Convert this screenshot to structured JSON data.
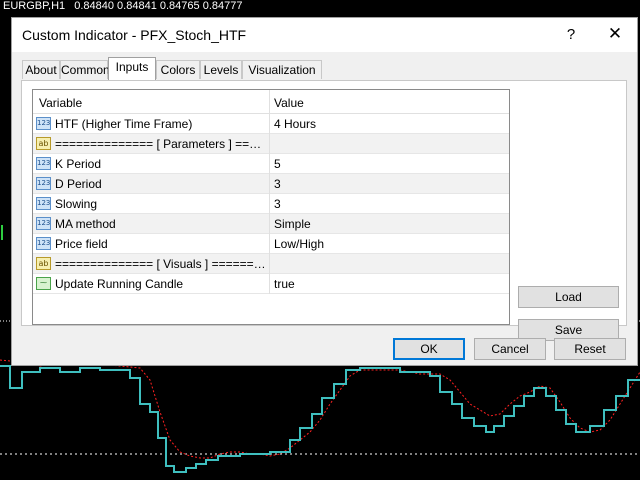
{
  "chart": {
    "symbol": "EURGBP,H1",
    "prices": [
      "0.84840",
      "0.84841",
      "0.84765",
      "0.84777"
    ],
    "stoch_color": "#3fbfbf",
    "signal_color": "#ff2020"
  },
  "dialog": {
    "title": "Custom Indicator - PFX_Stoch_HTF",
    "help_glyph": "?",
    "close_glyph": "✕",
    "tabs": [
      {
        "label": "About"
      },
      {
        "label": "Common"
      },
      {
        "label": "Inputs",
        "active": true
      },
      {
        "label": "Colors"
      },
      {
        "label": "Levels"
      },
      {
        "label": "Visualization"
      }
    ],
    "table": {
      "headers": {
        "variable": "Variable",
        "value": "Value"
      },
      "rows": [
        {
          "icon": "123",
          "type": "number-icon",
          "variable": "HTF (Higher Time Frame)",
          "value": "4 Hours"
        },
        {
          "icon": "ab",
          "type": "string-icon",
          "variable": "============== [ Parameters ] ==============",
          "value": ""
        },
        {
          "icon": "123",
          "type": "number-icon",
          "variable": "K Period",
          "value": "5"
        },
        {
          "icon": "123",
          "type": "number-icon",
          "variable": "D Period",
          "value": "3"
        },
        {
          "icon": "123",
          "type": "number-icon",
          "variable": "Slowing",
          "value": "3"
        },
        {
          "icon": "123",
          "type": "number-icon",
          "variable": "MA method",
          "value": "Simple"
        },
        {
          "icon": "123",
          "type": "number-icon",
          "variable": "Price field",
          "value": "Low/High"
        },
        {
          "icon": "ab",
          "type": "string-icon",
          "variable": "============== [ Visuals ] ==============",
          "value": ""
        },
        {
          "icon": "⁓",
          "type": "bool-icon",
          "variable": "Update Running Candle",
          "value": "true"
        }
      ]
    },
    "side_buttons": {
      "load": "Load",
      "save": "Save"
    },
    "footer_buttons": {
      "ok": "OK",
      "cancel": "Cancel",
      "reset": "Reset"
    },
    "accent_color": "#0078d7"
  }
}
